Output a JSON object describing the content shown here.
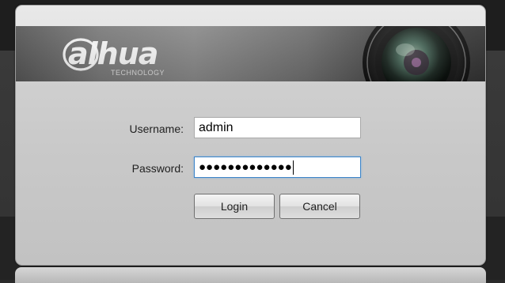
{
  "brand": {
    "logo_text": "alhua",
    "logo_subtext": "TECHNOLOGY"
  },
  "login": {
    "username_label": "Username:",
    "username_value": "admin",
    "password_label": "Password:",
    "password_masked": "●●●●●●●●●●●●●",
    "login_button": "Login",
    "cancel_button": "Cancel"
  },
  "colors": {
    "focus_border": "#3c84c8",
    "banner_dark": "#333333",
    "dialog_bg": "#cfcfcf"
  }
}
